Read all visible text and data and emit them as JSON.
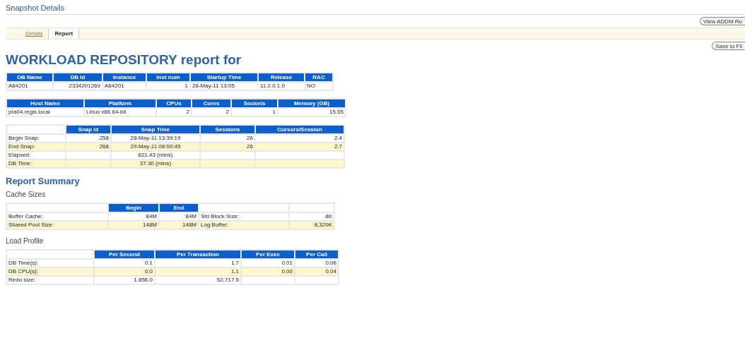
{
  "title": "Snapshot Details",
  "top_button": "View ADDM Ru",
  "tabs": [
    {
      "label": "Details",
      "selected": false
    },
    {
      "label": "Report",
      "selected": true
    }
  ],
  "save_button": "Save to Fil",
  "blocks": [
    {
      "kind": "title",
      "text": "WORKLOAD REPOSITORY report for"
    },
    {
      "kind": "table",
      "columns": [
        "DB Name",
        "DB Id",
        "Instance",
        "Inst num",
        "Startup Time",
        "Release",
        "RAC"
      ],
      "rows": [
        [
          "A64201",
          "2334201269",
          "A64201",
          "1",
          "28-May-11 13:05",
          "11.2.0.1.0",
          "NO"
        ]
      ]
    },
    {
      "kind": "table",
      "columns": [
        "Host Name",
        "Platform",
        "CPUs",
        "Cores",
        "Sockets",
        "Memory (GB)"
      ],
      "rows": [
        [
          "pra04.regis.local",
          "Linux x86 64-bit",
          "2",
          "2",
          "1",
          "15.55"
        ]
      ]
    },
    {
      "kind": "table",
      "columns": [
        null,
        "Snap Id",
        "Snap Time",
        "Sessions",
        "Cursors/Session"
      ],
      "rows": [
        [
          "Begin Snap:",
          "258",
          "28-May-11 13:39:19",
          "26",
          "2.4"
        ],
        [
          "End Snap:",
          "268",
          "29-May-11 08:00:45",
          "26",
          "2.7"
        ],
        [
          "Elapsed:",
          null,
          "621.43 (mins)",
          null,
          null
        ],
        [
          "DB Time:",
          null,
          "37.30 (mins)",
          null,
          null
        ]
      ]
    },
    {
      "kind": "heading",
      "text": "Report Summary"
    },
    {
      "kind": "subheading",
      "text": "Cache Sizes"
    },
    {
      "kind": "table",
      "columns": [
        null,
        "Begin",
        "End",
        null,
        null
      ],
      "rows": [
        [
          "Buffer Cache:",
          "84M",
          "84M",
          "Std Block Size:",
          "8K"
        ],
        [
          "Shared Pool Size:",
          "148M",
          "148M",
          "Log Buffer:",
          "8,320K"
        ]
      ]
    },
    {
      "kind": "subheading",
      "text": "Load Profile"
    },
    {
      "kind": "table",
      "columns": [
        null,
        "Per Second",
        "Per Transaction",
        "Per Exec",
        "Per Call"
      ],
      "rows": [
        [
          "DB Time(s):",
          "0.1",
          "1.7",
          "0.01",
          "0.06"
        ],
        [
          "DB CPU(s):",
          "0.0",
          "1.1",
          "0.00",
          "0.04"
        ],
        [
          "Redo size:",
          "1,856.0",
          "52,717.5",
          null,
          null
        ]
      ]
    }
  ]
}
